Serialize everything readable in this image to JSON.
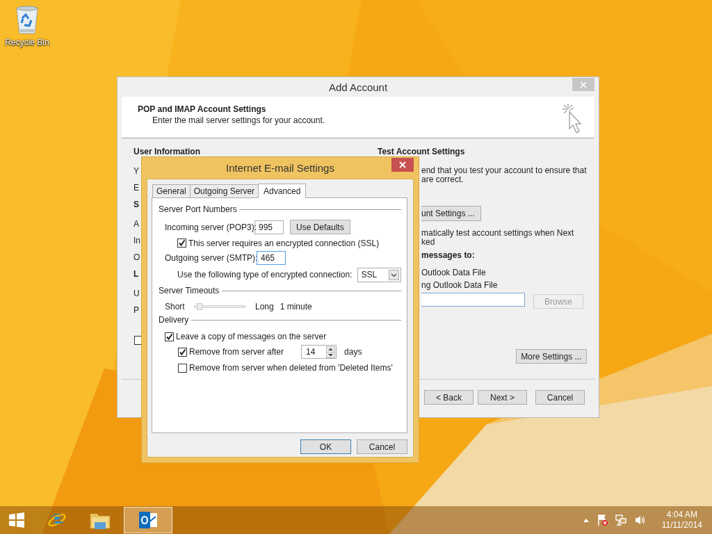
{
  "desktop_icons": [
    {
      "label": "Recycle Bin"
    }
  ],
  "add_account": {
    "title": "Add Account",
    "heading": "POP and IMAP Account Settings",
    "subheading": "Enter the mail server settings for your account.",
    "left_items": [
      {
        "kind": "heading",
        "text": "User Information"
      },
      {
        "kind": "label",
        "text": "Y"
      },
      {
        "kind": "label",
        "text": "E"
      },
      {
        "kind": "heading",
        "text": "S"
      },
      {
        "kind": "label",
        "text": "A"
      },
      {
        "kind": "label",
        "text": "In"
      },
      {
        "kind": "label",
        "text": "O"
      },
      {
        "kind": "heading",
        "text": "L"
      },
      {
        "kind": "label",
        "text": "U"
      },
      {
        "kind": "label",
        "text": "P"
      }
    ],
    "left_checkbox": {
      "checked": false
    },
    "right_items": [
      {
        "kind": "heading",
        "text": "Test Account Settings"
      },
      {
        "kind": "text",
        "text": "end that you test your account to ensure that"
      },
      {
        "kind": "text",
        "text": "are correct."
      },
      {
        "kind": "button",
        "text": "unt Settings ..."
      },
      {
        "kind": "text",
        "text": "matically test account settings when Next"
      },
      {
        "kind": "text",
        "text": "ked"
      },
      {
        "kind": "subheading",
        "text": "messages to:"
      },
      {
        "kind": "text",
        "text": "Outlook Data File"
      },
      {
        "kind": "text",
        "text": "ng Outlook Data File"
      },
      {
        "kind": "file",
        "button": "Browse",
        "disabled": true
      },
      {
        "kind": "more",
        "text": "More Settings ..."
      }
    ],
    "buttons": [
      "< Back",
      "Next >",
      "Cancel"
    ]
  },
  "email_settings": {
    "title": "Internet E-mail Settings",
    "tabs": [
      {
        "label": "General",
        "selected": false
      },
      {
        "label": "Outgoing Server",
        "selected": false
      },
      {
        "label": "Advanced",
        "selected": true
      }
    ],
    "ports": {
      "heading": "Server Port Numbers",
      "incoming_label": "Incoming server (POP3):",
      "incoming_value": "995",
      "use_defaults": "Use Defaults",
      "ssl": {
        "label": "This server requires an encrypted connection (SSL)",
        "checked": true
      },
      "outgoing_label": "Outgoing server (SMTP):",
      "outgoing_value": "465",
      "encryption_label": "Use the following type of encrypted connection:",
      "encryption_value": "SSL"
    },
    "timeouts": {
      "heading": "Server Timeouts",
      "short": "Short",
      "long": "Long",
      "level": 0.1,
      "reading": "1 minute"
    },
    "delivery": {
      "heading": "Delivery",
      "options": [
        {
          "label": "Leave a copy of messages on the server",
          "checked": true,
          "children": [
            {
              "label": "Remove from server after",
              "checked": true,
              "value": "14",
              "unit": "days"
            },
            {
              "label": "Remove from server when deleted from 'Deleted Items'",
              "checked": false
            }
          ]
        }
      ]
    },
    "buttons": [
      "OK",
      "Cancel"
    ]
  },
  "taskbar": {
    "apps": [
      {
        "kind": "start",
        "selected": false
      },
      {
        "kind": "browser",
        "selected": false
      },
      {
        "kind": "folder",
        "selected": false
      },
      {
        "kind": "mail",
        "selected": true
      }
    ],
    "time": "4:04 AM",
    "date": "11/11/2014"
  }
}
